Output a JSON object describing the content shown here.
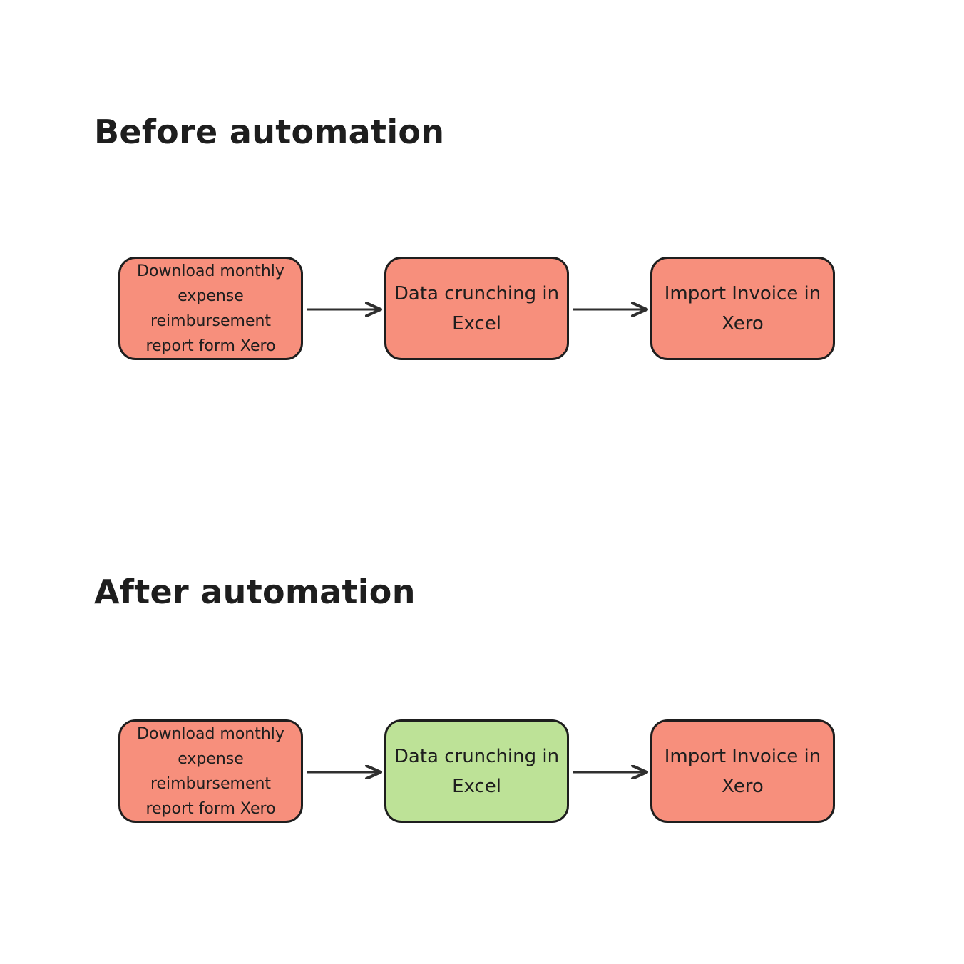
{
  "colors": {
    "pending": "#f78f7c",
    "automated": "#bde297",
    "border": "#1e1e1e",
    "arrow": "#2f2f2f"
  },
  "sections": [
    {
      "title": "Before automation",
      "steps": [
        {
          "label": "Download monthly expense reimbursement report form Xero",
          "status": "pending"
        },
        {
          "label": "Data crunching in Excel",
          "status": "pending"
        },
        {
          "label": "Import Invoice in Xero",
          "status": "pending"
        }
      ]
    },
    {
      "title": "After automation",
      "steps": [
        {
          "label": "Download monthly expense reimbursement report form Xero",
          "status": "pending"
        },
        {
          "label": "Data crunching in Excel",
          "status": "automated"
        },
        {
          "label": "Import Invoice in Xero",
          "status": "pending"
        }
      ]
    }
  ]
}
